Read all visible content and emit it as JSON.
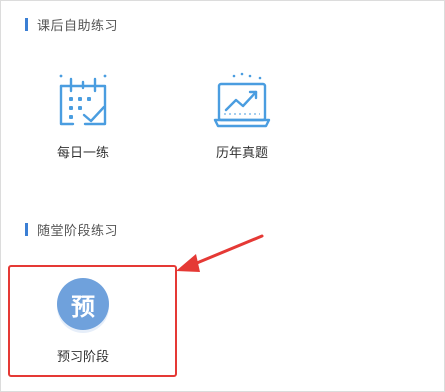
{
  "sections": {
    "self_study": {
      "title": "课后自助练习",
      "items": [
        {
          "label": "每日一练",
          "icon": "calendar-check-icon"
        },
        {
          "label": "历年真题",
          "icon": "chart-board-icon"
        }
      ]
    },
    "stage": {
      "title": "随堂阶段练习",
      "items": [
        {
          "label": "预习阶段",
          "badge": "预",
          "icon": "preview-badge-icon"
        }
      ]
    }
  },
  "colors": {
    "accent": "#3b7fd4",
    "icon_blue": "#4a9de0",
    "badge_blue": "#6fa1dc",
    "annotation_red": "#e53935"
  }
}
